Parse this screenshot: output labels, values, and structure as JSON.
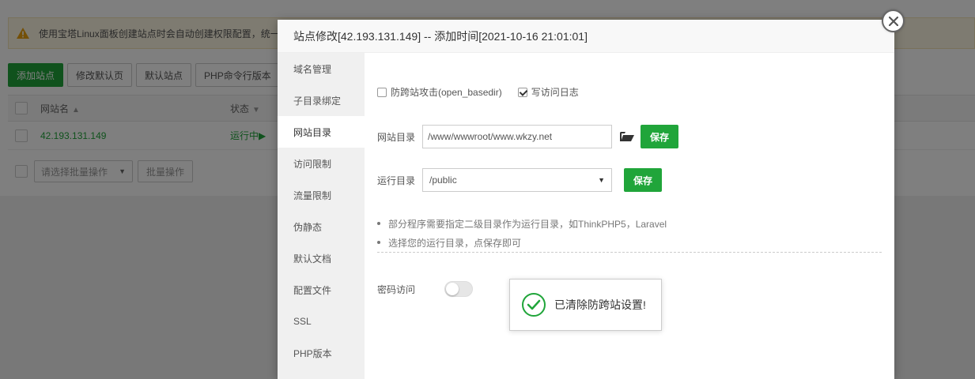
{
  "background": {
    "notice_text": "使用宝塔Linux面板创建站点时会自动创建权限配置，统一",
    "toolbar": [
      "添加站点",
      "修改默认页",
      "默认站点",
      "PHP命令行版本"
    ],
    "table": {
      "col_name": "网站名",
      "col_state": "状态",
      "rows": [
        {
          "name": "42.193.131.149",
          "state": "运行中▶"
        }
      ]
    },
    "batch_select_placeholder": "请选择批量操作",
    "batch_button": "批量操作"
  },
  "modal": {
    "title": "站点修改[42.193.131.149] -- 添加时间[2021-10-16 21:01:01]",
    "sidebar": [
      {
        "label": "域名管理"
      },
      {
        "label": "子目录绑定"
      },
      {
        "label": "网站目录",
        "active": true
      },
      {
        "label": "访问限制"
      },
      {
        "label": "流量限制"
      },
      {
        "label": "伪静态"
      },
      {
        "label": "默认文档"
      },
      {
        "label": "配置文件"
      },
      {
        "label": "SSL"
      },
      {
        "label": "PHP版本"
      }
    ],
    "anti_xss_label": "防跨站攻击(open_basedir)",
    "anti_xss_checked": false,
    "log_label": "写访问日志",
    "log_checked": true,
    "site_dir_label": "网站目录",
    "site_dir_value": "/www/wwwroot/www.wkzy.net",
    "save_label": "保存",
    "run_dir_label": "运行目录",
    "run_dir_value": "/public",
    "tips": [
      "部分程序需要指定二级目录作为运行目录，如ThinkPHP5，Laravel",
      "选择您的运行目录，点保存即可"
    ],
    "password_label": "密码访问",
    "password_enabled": false
  },
  "toast": {
    "message": "已清除防跨站设置!"
  },
  "colors": {
    "accent": "#20a53a"
  }
}
